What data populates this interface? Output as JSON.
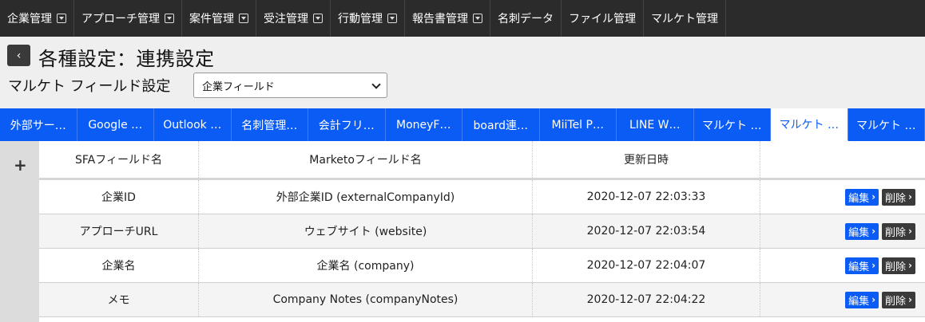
{
  "topnav": {
    "items": [
      {
        "label": "企業管理",
        "dropdown": true
      },
      {
        "label": "アプローチ管理",
        "dropdown": true
      },
      {
        "label": "案件管理",
        "dropdown": true
      },
      {
        "label": "受注管理",
        "dropdown": true
      },
      {
        "label": "行動管理",
        "dropdown": true
      },
      {
        "label": "報告書管理",
        "dropdown": true
      },
      {
        "label": "名刺データ",
        "dropdown": false
      },
      {
        "label": "ファイル管理",
        "dropdown": false
      },
      {
        "label": "マルケト管理",
        "dropdown": false
      }
    ]
  },
  "header": {
    "back_label": "‹",
    "title": "各種設定：連携設定",
    "subtitle": "マルケト フィールド設定",
    "select_value": "企業フィールド"
  },
  "tabs": [
    {
      "label": "外部サー…",
      "active": false
    },
    {
      "label": "Google …",
      "active": false
    },
    {
      "label": "Outlook …",
      "active": false
    },
    {
      "label": "名刺管理…",
      "active": false
    },
    {
      "label": "会計フリ…",
      "active": false
    },
    {
      "label": "MoneyF…",
      "active": false
    },
    {
      "label": "board連…",
      "active": false
    },
    {
      "label": "MiiTel P…",
      "active": false
    },
    {
      "label": "LINE W…",
      "active": false
    },
    {
      "label": "マルケト …",
      "active": false
    },
    {
      "label": "マルケト …",
      "active": true
    },
    {
      "label": "マルケト …",
      "active": false
    }
  ],
  "table": {
    "add_label": "+",
    "columns": [
      "SFAフィールド名",
      "Marketoフィールド名",
      "更新日時",
      ""
    ],
    "rows": [
      {
        "sfa": "企業ID",
        "marketo": "外部企業ID (externalCompanyId)",
        "updated": "2020-12-07 22:03:33"
      },
      {
        "sfa": "アプローチURL",
        "marketo": "ウェブサイト (website)",
        "updated": "2020-12-07 22:03:54"
      },
      {
        "sfa": "企業名",
        "marketo": "企業名 (company)",
        "updated": "2020-12-07 22:04:07"
      },
      {
        "sfa": "メモ",
        "marketo": "Company Notes (companyNotes)",
        "updated": "2020-12-07 22:04:22"
      }
    ],
    "edit_label": "編集",
    "delete_label": "削除"
  },
  "colors": {
    "nav_bg": "#2b2b2b",
    "tab_bg": "#0b5cf5",
    "edit_btn": "#0b5cf5",
    "delete_btn": "#3a3a3a"
  }
}
